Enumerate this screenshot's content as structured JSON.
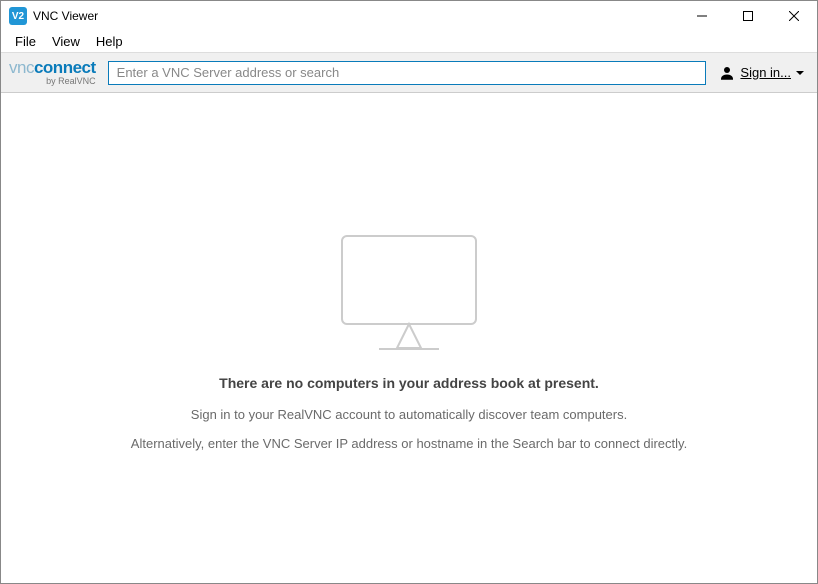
{
  "window": {
    "title": "VNC Viewer",
    "icon_text": "V2"
  },
  "menu": {
    "file": "File",
    "view": "View",
    "help": "Help"
  },
  "toolbar": {
    "brand_light": "vnc",
    "brand_bold": "connect",
    "brand_sub": "by RealVNC",
    "search_placeholder": "Enter a VNC Server address or search",
    "search_value": "",
    "signin_label": "Sign in..."
  },
  "main": {
    "heading": "There are no computers in your address book at present.",
    "line1": "Sign in to your RealVNC account to automatically discover team computers.",
    "line2": "Alternatively, enter the VNC Server IP address or hostname in the Search bar to connect directly."
  }
}
